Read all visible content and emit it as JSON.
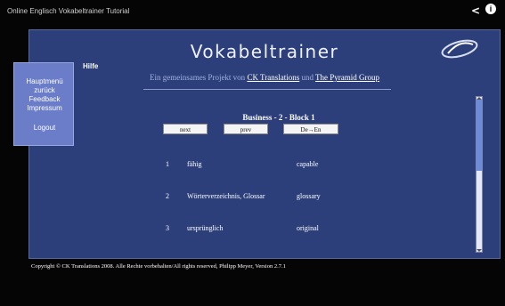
{
  "video": {
    "title": "Online Englisch Vokabeltrainer Tutorial",
    "share_icon": "share-icon",
    "info_icon": "info-icon",
    "info_label": "i"
  },
  "app": {
    "title": "Vokabeltrainer",
    "help": "Hilfe",
    "subtitle_prefix": "Ein gemeinsames Projekt von",
    "subtitle_link1": "CK Translations",
    "subtitle_and": "und",
    "subtitle_link2": "The Pyramid Group",
    "logo_icon": "ck-logo-icon"
  },
  "menu": {
    "items": [
      "Hauptmenü",
      "zurück",
      "Feedback",
      "Impressum",
      "Logout"
    ]
  },
  "block": {
    "title": "Business - 2 - Block 1",
    "buttons": {
      "next": "next",
      "prev": "prev",
      "direction": "De→En"
    }
  },
  "vocab": [
    {
      "num": "1",
      "de": "fähig",
      "en": "capable"
    },
    {
      "num": "2",
      "de": "Wörterverzeichnis, Glossar",
      "en": "glossary"
    },
    {
      "num": "3",
      "de": "ursprünglich",
      "en": "original"
    }
  ],
  "footer": {
    "copyright": "Copyright © CK Translations 2008. Alle Rechte vorbehalten/All rights reserved, Philipp Meyer, Version 2.7.1"
  },
  "colors": {
    "frame_bg": "#2c3f7a",
    "menu_bg": "#6b7dc8",
    "scroll_thumb": "#6c8bd8"
  }
}
